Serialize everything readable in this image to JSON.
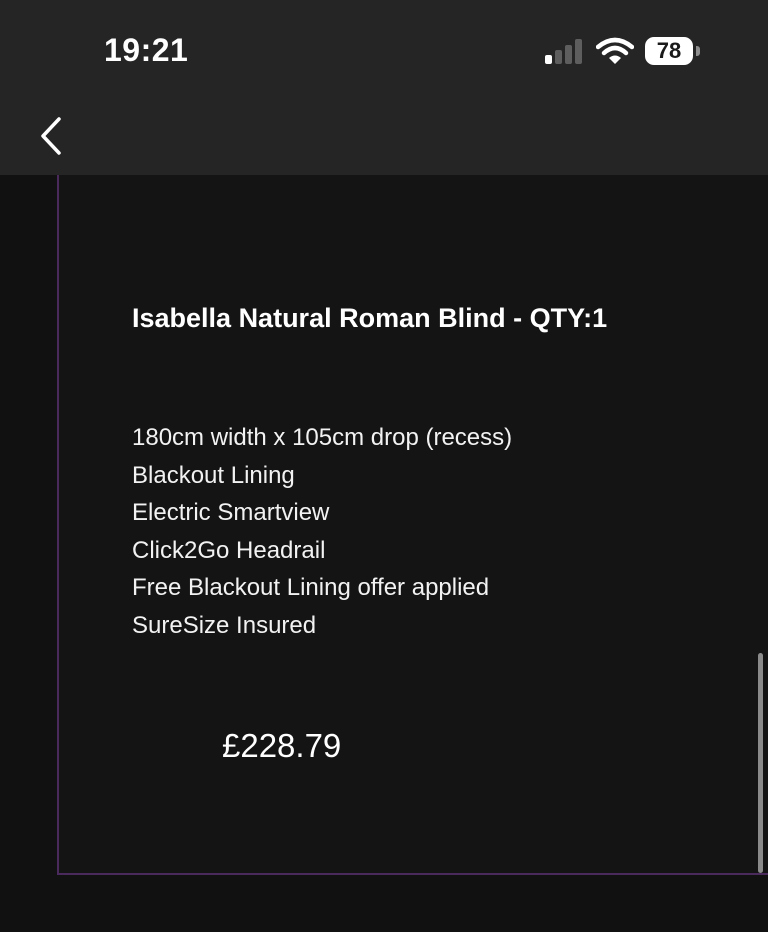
{
  "status_bar": {
    "time": "19:21",
    "battery_level": "78",
    "signal_icon": "cellular-signal-icon",
    "wifi_icon": "wifi-icon",
    "battery_icon": "battery-icon",
    "signal_bars_active": 1
  },
  "nav": {
    "back_icon": "chevron-left-icon"
  },
  "product": {
    "title": "Isabella Natural Roman Blind - QTY:1",
    "specs": [
      "180cm width x 105cm drop (recess)",
      "Blackout Lining",
      "Electric Smartview",
      "Click2Go Headrail",
      "Free Blackout Lining offer applied",
      "SureSize Insured"
    ],
    "price": "£228.79"
  },
  "colors": {
    "background": "#111111",
    "bar": "#252525",
    "panel_border": "#4a2a5c",
    "text": "#ffffff"
  }
}
